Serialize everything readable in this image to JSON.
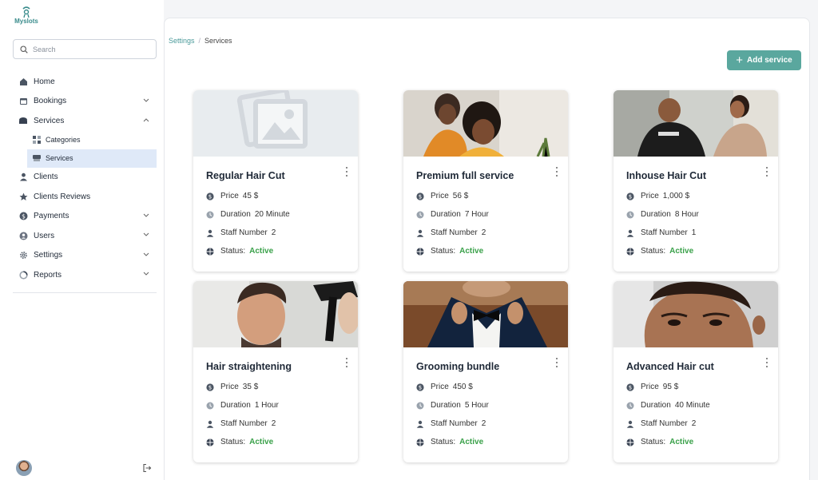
{
  "app": {
    "name": "Myslots"
  },
  "search": {
    "placeholder": "Search"
  },
  "sidebar": {
    "items": [
      {
        "label": "Home",
        "icon": "home-icon"
      },
      {
        "label": "Bookings",
        "icon": "calendar-icon",
        "expandable": true
      },
      {
        "label": "Services",
        "icon": "services-icon",
        "expandable": true,
        "expanded": true
      },
      {
        "label": "Clients",
        "icon": "user-icon"
      },
      {
        "label": "Clients Reviews",
        "icon": "star-icon"
      },
      {
        "label": "Payments",
        "icon": "dollar-icon",
        "expandable": true
      },
      {
        "label": "Users",
        "icon": "users-icon",
        "expandable": true
      },
      {
        "label": "Settings",
        "icon": "gear-icon",
        "expandable": true
      },
      {
        "label": "Reports",
        "icon": "chart-pie-icon",
        "expandable": true
      }
    ],
    "services_sub": [
      {
        "label": "Categories",
        "icon": "grid-icon"
      },
      {
        "label": "Services",
        "icon": "services-icon",
        "active": true
      }
    ]
  },
  "breadcrumb": {
    "parent": "Settings",
    "separator": "/",
    "current": "Services"
  },
  "toolbar": {
    "add_label": "Add service"
  },
  "labels": {
    "price": "Price",
    "duration": "Duration",
    "staff": "Staff Number",
    "status": "Status:"
  },
  "colors": {
    "accent": "#5aa79e",
    "active_status": "#3aa14a",
    "nav_active_bg": "#dfe9f8"
  },
  "services": [
    {
      "title": "Regular Hair Cut",
      "price": "45 $",
      "duration": "20 Minute",
      "staff": "2",
      "status": "Active",
      "image": "placeholder-image"
    },
    {
      "title": "Premium full service",
      "price": "56 $",
      "duration": "7 Hour",
      "staff": "2",
      "status": "Active",
      "image": "salon-photo"
    },
    {
      "title": "Inhouse Hair Cut",
      "price": "1,000 $",
      "duration": "8 Hour",
      "staff": "1",
      "status": "Active",
      "image": "barber-photo"
    },
    {
      "title": "Hair straightening",
      "price": "35 $",
      "duration": "1 Hour",
      "staff": "2",
      "status": "Active",
      "image": "hairdryer-photo"
    },
    {
      "title": "Grooming bundle",
      "price": "450 $",
      "duration": "5 Hour",
      "staff": "2",
      "status": "Active",
      "image": "bowtie-photo"
    },
    {
      "title": "Advanced Hair cut",
      "price": "95 $",
      "duration": "40 Minute",
      "staff": "2",
      "status": "Active",
      "image": "face-photo"
    }
  ]
}
